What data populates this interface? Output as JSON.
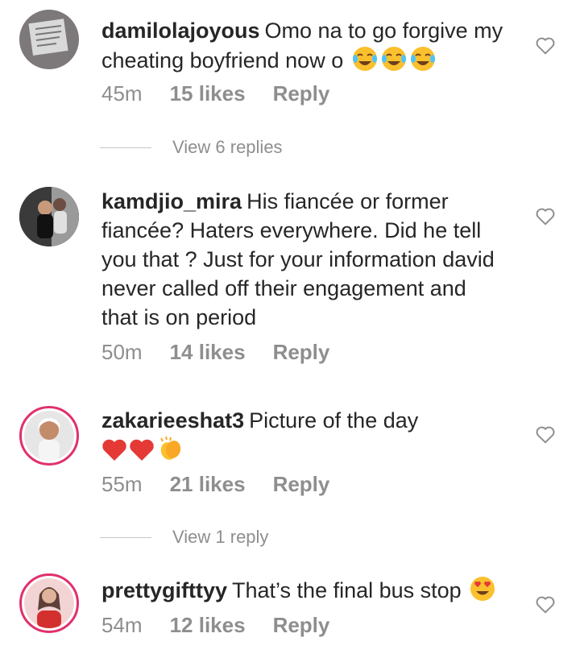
{
  "comments": [
    {
      "username": "damilolajoyous",
      "text": "Omo na to go forgive my cheating boyfriend now o",
      "emoji": [
        "face-with-tears-of-joy",
        "face-with-tears-of-joy",
        "face-with-tears-of-joy"
      ],
      "time": "45m",
      "likes": "15 likes",
      "reply": "Reply",
      "view_replies": "View 6 replies"
    },
    {
      "username": "kamdjio_mira",
      "text": "His fiancée or former fiancée? Haters everywhere. Did he tell you that ? Just for your information david never called off their engagement and that is on period",
      "emoji": [],
      "time": "50m",
      "likes": "14 likes",
      "reply": "Reply"
    },
    {
      "username": "zakarieeshat3",
      "text": "Picture of the day",
      "emoji": [
        "red-heart",
        "red-heart",
        "clapping-hands"
      ],
      "time": "55m",
      "likes": "21 likes",
      "reply": "Reply",
      "view_replies": "View 1 reply"
    },
    {
      "username": "prettygifttyy",
      "text": "That’s the final bus stop",
      "emoji": [
        "smiling-face-with-heart-eyes"
      ],
      "time": "54m",
      "likes": "12 likes",
      "reply": "Reply"
    }
  ],
  "colors": {
    "text": "#262626",
    "meta": "#8e8e8e",
    "story_ring": "#e1306c",
    "divider": "#c7c7c7"
  }
}
